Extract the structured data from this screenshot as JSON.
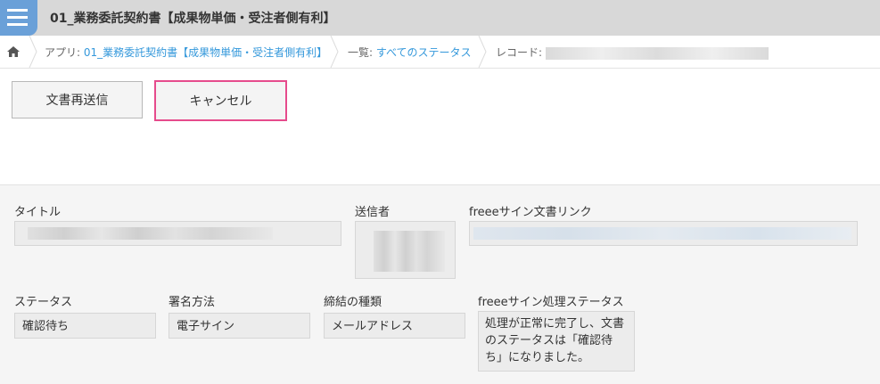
{
  "header": {
    "title": "01_業務委託契約書【成果物単価・受注者側有利】"
  },
  "breadcrumb": {
    "app_prefix": "アプリ: ",
    "app_name": "01_業務委託契約書【成果物単価・受注者側有利】",
    "list_prefix": "一覧: ",
    "list_name": "すべてのステータス",
    "record_prefix": "レコード: "
  },
  "toolbar": {
    "resend_label": "文書再送信",
    "cancel_label": "キャンセル"
  },
  "form": {
    "title_label": "タイトル",
    "sender_label": "送信者",
    "link_label": "freeeサイン文書リンク",
    "status_label": "ステータス",
    "status_value": "確認待ち",
    "sign_method_label": "署名方法",
    "sign_method_value": "電子サイン",
    "binding_type_label": "締結の種類",
    "binding_type_value": "メールアドレス",
    "process_status_label": "freeeサイン処理ステータス",
    "process_status_value": "処理が正常に完了し、文書のステータスは「確認待ち」になりました。"
  },
  "colors": {
    "accent": "#3498db",
    "cancel_border": "#e64b8c",
    "app_icon": "#6aa0d8"
  }
}
